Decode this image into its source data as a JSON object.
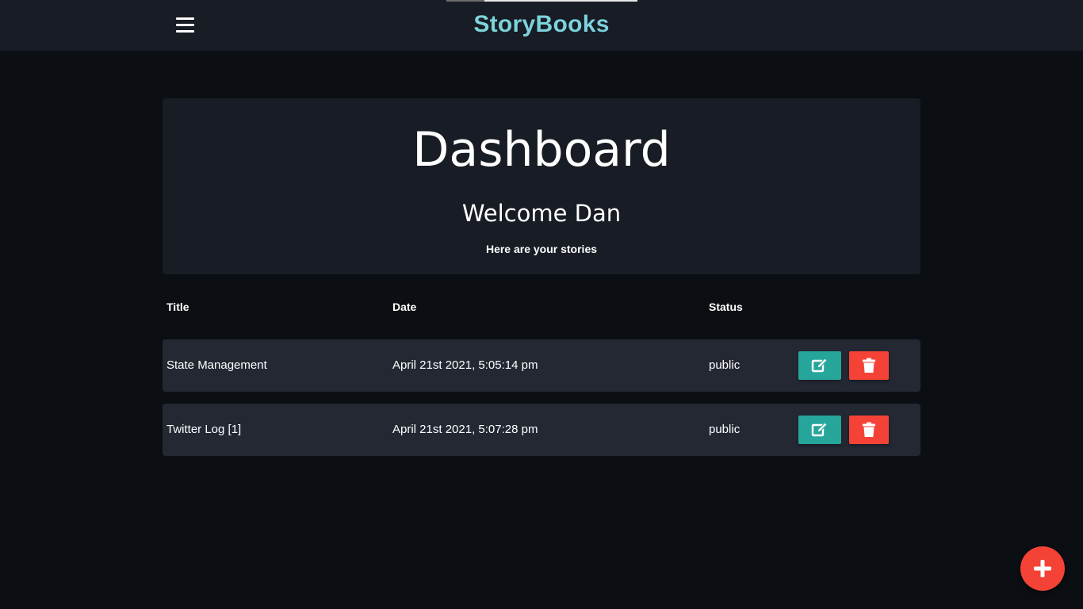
{
  "navbar": {
    "brand": "StoryBooks",
    "brand_gradient": [
      "#7fe3c9",
      "#7ac3f0"
    ],
    "menu_icon": "hamburger-menu-icon"
  },
  "hero": {
    "title": "Dashboard",
    "welcome": "Welcome Dan",
    "subtitle": "Here are your stories"
  },
  "table": {
    "headers": {
      "title": "Title",
      "date": "Date",
      "status": "Status"
    },
    "rows": [
      {
        "title": "State Management",
        "date": "April 21st 2021, 5:05:14 pm",
        "status": "public",
        "edit_icon": "edit-icon",
        "delete_icon": "trash-icon"
      },
      {
        "title": "Twitter Log [1]",
        "date": "April 21st 2021, 5:07:28 pm",
        "status": "public",
        "edit_icon": "edit-icon",
        "delete_icon": "trash-icon"
      }
    ]
  },
  "fab": {
    "icon": "plus-icon"
  },
  "colors": {
    "background": "#0b0e12",
    "navbar": "#181c24",
    "card": "#181c24",
    "row": "#232833",
    "edit_button": "#26a69a",
    "delete_button": "#f44336",
    "fab": "#f44336"
  }
}
